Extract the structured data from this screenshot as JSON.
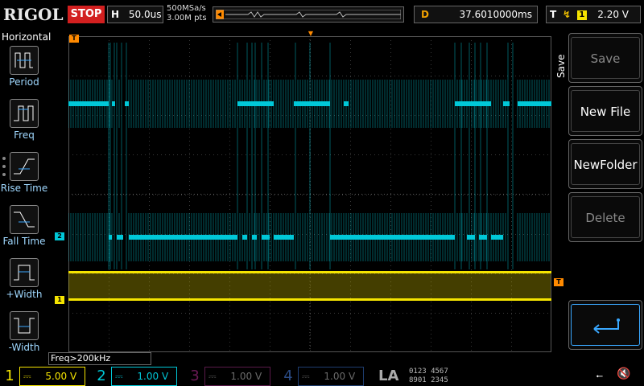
{
  "topbar": {
    "brand": "RIGOL",
    "run_state": "STOP",
    "horizontal_label": "H",
    "horizontal_scale": "50.0us",
    "sample_rate": "500MSa/s",
    "memory_depth": "3.00M pts",
    "delay_label": "D",
    "delay_value": "37.6010000ms",
    "trigger_label": "T",
    "trigger_source": "1",
    "trigger_level": "2.20 V"
  },
  "left_panel": {
    "title": "Horizontal",
    "items": [
      {
        "label": "Period",
        "icon": "period-icon"
      },
      {
        "label": "Freq",
        "icon": "freq-icon"
      },
      {
        "label": "Rise Time",
        "icon": "rise-time-icon"
      },
      {
        "label": "Fall Time",
        "icon": "fall-time-icon"
      },
      {
        "label": "+Width",
        "icon": "positive-width-icon"
      },
      {
        "label": "-Width",
        "icon": "negative-width-icon"
      }
    ]
  },
  "measurement": "Freq>200kHz",
  "markers": {
    "trigger_top": "T",
    "ch2": "2",
    "ch1": "1",
    "trigger_right": "T"
  },
  "right_panel": {
    "tab_label": "Save",
    "buttons": [
      {
        "label": "Save",
        "enabled": false
      },
      {
        "label": "New File",
        "enabled": true
      },
      {
        "label": "NewFolder",
        "enabled": true
      },
      {
        "label": "Delete",
        "enabled": false
      }
    ]
  },
  "bottom": {
    "channels": [
      {
        "num": "1",
        "scale": "5.00 V",
        "color": "#f5e400",
        "active": true
      },
      {
        "num": "2",
        "scale": "1.00 V",
        "color": "#00c8d8",
        "active": true
      },
      {
        "num": "3",
        "scale": "1.00 V",
        "color": "#b0278e",
        "active": false
      },
      {
        "num": "4",
        "scale": "1.00 V",
        "color": "#2b6cd6",
        "active": false
      }
    ],
    "la_label": "LA",
    "la_digits_row1": "0123 4567",
    "la_digits_row2": "8901 2345"
  },
  "colors": {
    "ch1": "#f5e400",
    "ch2": "#00c8d8",
    "trigger": "#ff8a00",
    "stop": "#d21f1f"
  }
}
